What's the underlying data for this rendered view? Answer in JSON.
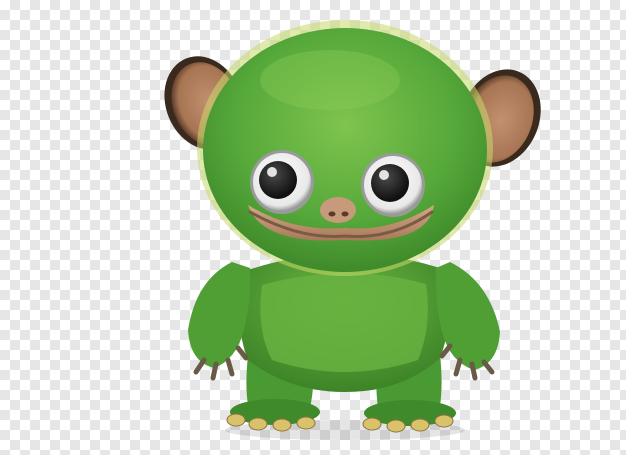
{
  "image": {
    "subject": "green-fuzzy-monster-toy",
    "background": "transparency-checkerboard"
  },
  "colors": {
    "checker_light": "#ffffff",
    "checker_dark": "#e6e6e6",
    "fur_main": "#55a83a",
    "fur_dark": "#3f8a2a",
    "fur_light": "#8fcf5a",
    "fur_rim": "#c9d86a",
    "ear_outer": "#3a2a1e",
    "ear_inner": "#b08060",
    "skin_face": "#c49a78",
    "eye_white": "#f4f4f4",
    "pupil": "#1f1f1f",
    "claw": "#d9c26a",
    "claw_dark": "#6a5a48"
  }
}
